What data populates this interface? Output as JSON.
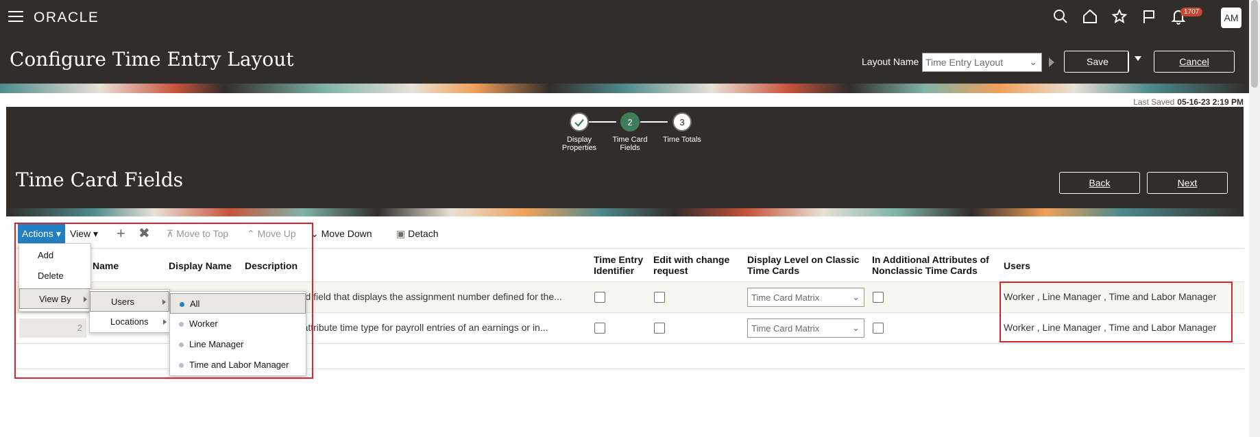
{
  "app": {
    "logo": "ORACLE",
    "notification_count": "1707",
    "avatar_initials": "AM"
  },
  "header": {
    "title": "Configure Time Entry Layout",
    "layout_name_label": "Layout Name",
    "layout_name_value": "Time Entry Layout",
    "save_label": "Save",
    "cancel_label": "Cancel"
  },
  "status": {
    "last_saved_label": "Last Saved",
    "last_saved_value": "05-16-23 2:19 PM"
  },
  "train": {
    "steps": [
      {
        "number": "",
        "label_line1": "Display",
        "label_line2": "Properties",
        "state": "done"
      },
      {
        "number": "2",
        "label_line1": "Time Card",
        "label_line2": "Fields",
        "state": "current"
      },
      {
        "number": "3",
        "label_line1": "Time Totals",
        "label_line2": "",
        "state": "pending"
      }
    ]
  },
  "section": {
    "title": "Time Card Fields",
    "back_label": "Back",
    "next_label": "Next"
  },
  "toolbar": {
    "actions_label": "Actions",
    "view_label": "View",
    "add_icon": "plus-icon",
    "delete_icon": "x-icon",
    "move_to_top_label": "Move to Top",
    "move_up_label": "Move Up",
    "move_down_label": "Move Down",
    "detach_label": "Detach"
  },
  "actions_menu": {
    "items": [
      "Add",
      "Delete",
      "View By"
    ],
    "view_by_submenu": [
      "Users",
      "Locations"
    ],
    "users_submenu": [
      "All",
      "Worker",
      "Line Manager",
      "Time and Labor Manager"
    ],
    "users_selected": "All"
  },
  "table": {
    "headers": {
      "name": "Name",
      "display_name": "Display Name",
      "description": "Description",
      "time_entry_identifier_1": "Time Entry",
      "time_entry_identifier_2": "Identifier",
      "edit_with_change_1": "Edit with change",
      "edit_with_change_2": "request",
      "display_level_1": "Display Level on Classic",
      "display_level_2": "Time Cards",
      "additional_attr_1": "In Additional Attributes of",
      "additional_attr_2": "Nonclassic Time Cards",
      "users": "Users"
    },
    "rows": [
      {
        "row_number": "",
        "description": "card field that displays the assignment number defined for the...",
        "display_level": "Time Card Matrix",
        "users": "Worker , Line Manager , Time and Labor Manager"
      },
      {
        "row_number": "2",
        "description": "le-attribute time type for payroll entries of an earnings or in...",
        "display_level": "Time Card Matrix",
        "users": "Worker , Line Manager , Time and Labor Manager"
      }
    ]
  },
  "colors": {
    "brand_dark": "#312d2a",
    "accent_blue": "#227fc1",
    "step_current": "#3f7d5a",
    "highlight_red": "#e0202a",
    "notification_red": "#c74634"
  }
}
